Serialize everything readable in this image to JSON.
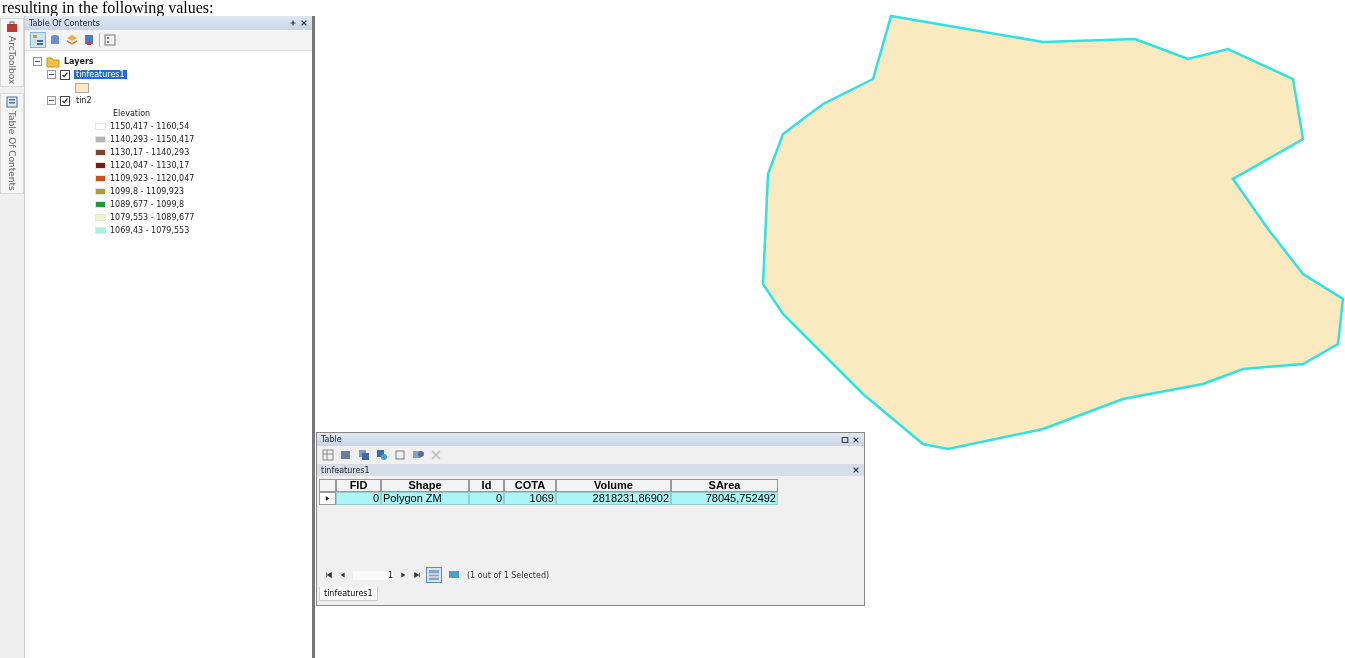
{
  "doc_text": "resulting in the following values:",
  "side_tabs": [
    {
      "label": "ArcToolbox"
    },
    {
      "label": "Table Of Contents"
    }
  ],
  "toc": {
    "title": "Table Of Contents",
    "root": {
      "label": "Layers",
      "expanded": true,
      "children": [
        {
          "label": "tinfeatures1",
          "checked": true,
          "selected": true,
          "expanded": true
        },
        {
          "label": "tin2",
          "checked": true,
          "selected": false,
          "expanded": true,
          "field": "Elevation",
          "classes": [
            {
              "label": "1150,417 - 1160,54",
              "color": "#ffffff"
            },
            {
              "label": "1140,293 - 1150,417",
              "color": "#b4b4b4"
            },
            {
              "label": "1130,17 - 1140,293",
              "color": "#7a4630"
            },
            {
              "label": "1120,047 - 1130,17",
              "color": "#7a1a0a"
            },
            {
              "label": "1109,923 - 1120,047",
              "color": "#c8501a"
            },
            {
              "label": "1099,8 - 1109,923",
              "color": "#a8a030"
            },
            {
              "label": "1089,677 - 1099,8",
              "color": "#1e9a3a"
            },
            {
              "label": "1079,553 - 1089,677",
              "color": "#eef8b8"
            },
            {
              "label": "1069,43 - 1079,553",
              "color": "#aef0e0"
            }
          ]
        }
      ]
    }
  },
  "table": {
    "title": "Table",
    "layer_tab": "tinfeatures1",
    "columns": [
      "FID",
      "Shape",
      "Id",
      "COTA",
      "Volume",
      "SArea"
    ],
    "rows": [
      {
        "selected": true,
        "cells": [
          "0",
          "Polygon ZM",
          "0",
          "1069",
          "2818231,86902",
          "78045,752492"
        ]
      }
    ],
    "record": "1",
    "status": "(1 out of 1 Selected)",
    "bottom_tab": "tinfeatures1"
  }
}
